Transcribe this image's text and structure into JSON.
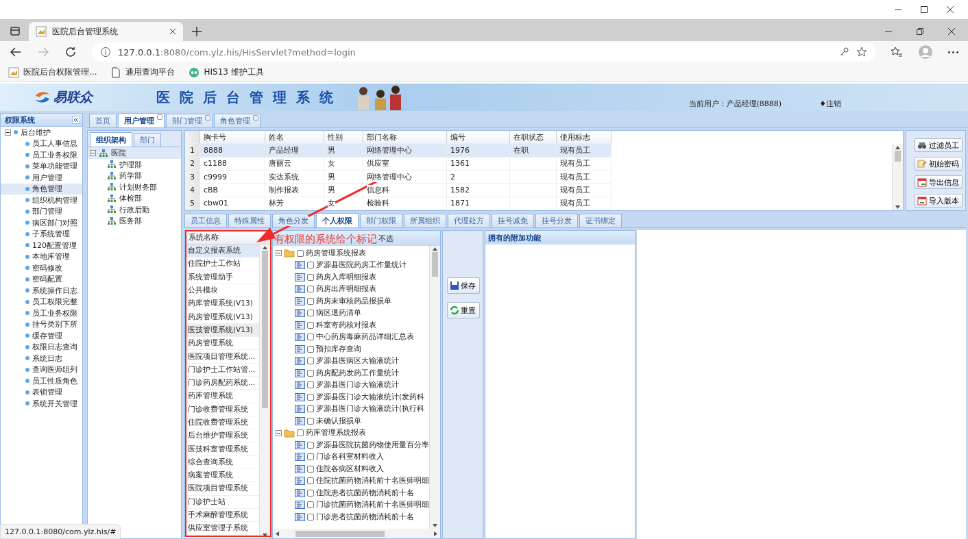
{
  "browser": {
    "tab_title": "医院后台管理系统",
    "url_host": "127.0.0.1",
    "url_rest": ":8080/com.ylz.his/HisServlet?method=login",
    "bookmarks": [
      {
        "label": "医院后台权限管理...",
        "kind": "app"
      },
      {
        "label": "通用查询平台",
        "kind": "page"
      },
      {
        "label": "HIS13 维护工具",
        "kind": "tool"
      }
    ]
  },
  "header": {
    "brand": "易联众",
    "title": "医院后台管理系统",
    "current_user": "当前用户：产品经理(8888)",
    "logout": "♦注销"
  },
  "sidebar": {
    "title": "权限系统",
    "root": {
      "label": "后台维护",
      "expanded": true,
      "children": [
        {
          "label": "员工人事信息",
          "selected": false
        },
        {
          "label": "员工业务权限",
          "selected": false
        },
        {
          "label": "菜单功能管理",
          "selected": false
        },
        {
          "label": "用户管理",
          "selected": false
        },
        {
          "label": "角色管理",
          "selected": true
        },
        {
          "label": "组织机构管理",
          "selected": false
        },
        {
          "label": "部门管理",
          "selected": false
        },
        {
          "label": "病区部门对照",
          "selected": false
        },
        {
          "label": "子系统管理",
          "selected": false
        },
        {
          "label": "120配置管理",
          "selected": false
        },
        {
          "label": "本地库管理",
          "selected": false
        },
        {
          "label": "密码修改",
          "selected": false
        },
        {
          "label": "密码配置",
          "selected": false
        },
        {
          "label": "系统操作日志",
          "selected": false
        },
        {
          "label": "员工权限完整",
          "selected": false
        },
        {
          "label": "员工业务权限",
          "selected": false
        },
        {
          "label": "挂号类别下所",
          "selected": false
        },
        {
          "label": "缓存管理",
          "selected": false
        },
        {
          "label": "权限日志查询",
          "selected": false
        },
        {
          "label": "系统日志",
          "selected": false
        },
        {
          "label": "查询医师组列",
          "selected": false
        },
        {
          "label": "员工性质角色",
          "selected": false
        },
        {
          "label": "表锁管理",
          "selected": false
        },
        {
          "label": "系统开关管理",
          "selected": false
        }
      ]
    }
  },
  "main_tabs": [
    {
      "label": "首页",
      "selected": false,
      "closable": false
    },
    {
      "label": "用户管理",
      "selected": true,
      "closable": true
    },
    {
      "label": "部门管理",
      "selected": false,
      "closable": true
    },
    {
      "label": "角色管理",
      "selected": false,
      "closable": true
    }
  ],
  "org_tabs": [
    {
      "label": "组织架构",
      "selected": true
    },
    {
      "label": "部门",
      "selected": false
    }
  ],
  "org_tree": {
    "label": "医院",
    "expanded": true,
    "selected": true,
    "children": [
      {
        "label": "护理部"
      },
      {
        "label": "药学部"
      },
      {
        "label": "计划财务部"
      },
      {
        "label": "体检部"
      },
      {
        "label": "行政后勤"
      },
      {
        "label": "医务部"
      }
    ]
  },
  "table": {
    "columns": [
      "胸卡号",
      "姓名",
      "性别",
      "部门名称",
      "编号",
      "在职状态",
      "使用标志"
    ],
    "rows": [
      {
        "index": "1",
        "selected": true,
        "cells": [
          "8888",
          "产品经理",
          "男",
          "网络管理中心",
          "1976",
          "在职",
          "现有员工"
        ]
      },
      {
        "index": "2",
        "selected": false,
        "cells": [
          "c1188",
          "唐丽云",
          "女",
          "供应室",
          "1361",
          "",
          "现有员工"
        ]
      },
      {
        "index": "3",
        "selected": false,
        "cells": [
          "c9999",
          "实达系统",
          "男",
          "网络管理中心",
          "2",
          "",
          "现有员工"
        ]
      },
      {
        "index": "4",
        "selected": false,
        "cells": [
          "cBB",
          "制作报表",
          "男",
          "信息科",
          "1582",
          "",
          "现有员工"
        ]
      },
      {
        "index": "5",
        "selected": false,
        "cells": [
          "cbw01",
          "林芳",
          "女",
          "检验科",
          "1871",
          "",
          "现有员工"
        ]
      }
    ]
  },
  "actions": [
    {
      "label": "过滤员工",
      "kind": "filter"
    },
    {
      "label": "初始密码",
      "kind": "password"
    },
    {
      "label": "导出信息",
      "kind": "export"
    },
    {
      "label": "导入版本",
      "kind": "import"
    }
  ],
  "detail_tabs": [
    {
      "label": "员工信息",
      "selected": false
    },
    {
      "label": "特殊属性",
      "selected": false
    },
    {
      "label": "角色分发",
      "selected": false
    },
    {
      "label": "个人权限",
      "selected": true
    },
    {
      "label": "部门权限",
      "selected": false
    },
    {
      "label": "所属组织",
      "selected": false
    },
    {
      "label": "代理处方",
      "selected": false
    },
    {
      "label": "挂号减免",
      "selected": false
    },
    {
      "label": "挂号分发",
      "selected": false
    },
    {
      "label": "证书绑定",
      "selected": false
    }
  ],
  "systems": {
    "header": "系统名称",
    "items": [
      {
        "label": "自定义报表系统",
        "selected": true,
        "hovered": false
      },
      {
        "label": "住院护士工作站",
        "selected": false,
        "hovered": false
      },
      {
        "label": "系统管理助手",
        "selected": false,
        "hovered": false
      },
      {
        "label": "公共模块",
        "selected": false,
        "hovered": false
      },
      {
        "label": "药库管理系统(V13)",
        "selected": false,
        "hovered": false
      },
      {
        "label": "药房管理系统(V13)",
        "selected": false,
        "hovered": false
      },
      {
        "label": "医技管理系统(V13)",
        "selected": false,
        "hovered": true
      },
      {
        "label": "药房管理系统",
        "selected": false,
        "hovered": false
      },
      {
        "label": "医院项目管理系统...",
        "selected": false,
        "hovered": false
      },
      {
        "label": "门诊护士工作站管...",
        "selected": false,
        "hovered": false
      },
      {
        "label": "门诊药房配药系统...",
        "selected": false,
        "hovered": false
      },
      {
        "label": "药库管理系统",
        "selected": false,
        "hovered": false
      },
      {
        "label": "门诊收费管理系统",
        "selected": false,
        "hovered": false
      },
      {
        "label": "住院收费管理系统",
        "selected": false,
        "hovered": false
      },
      {
        "label": "后台维护管理系统",
        "selected": false,
        "hovered": false
      },
      {
        "label": "医技科室管理系统",
        "selected": false,
        "hovered": false
      },
      {
        "label": "综合查询系统",
        "selected": false,
        "hovered": false
      },
      {
        "label": "病案管理系统",
        "selected": false,
        "hovered": false
      },
      {
        "label": "医院项目管理系统",
        "selected": false,
        "hovered": false
      },
      {
        "label": "门诊护士站",
        "selected": false,
        "hovered": false
      },
      {
        "label": "手术麻醉管理系统",
        "selected": false,
        "hovered": false
      },
      {
        "label": "供应室管理子系统",
        "selected": false,
        "hovered": false
      }
    ]
  },
  "report_tree": {
    "toolbar_label": "不选",
    "groups": [
      {
        "label": "药房管理系统报表",
        "expanded": true,
        "checked": false,
        "children": [
          {
            "label": "罗源县医院药房工作量统计",
            "checked": false
          },
          {
            "label": "药房入库明细报表",
            "checked": false
          },
          {
            "label": "药房出库明细报表",
            "checked": false
          },
          {
            "label": "药房未审核药品报损单",
            "checked": false
          },
          {
            "label": "病区退药清单",
            "checked": false
          },
          {
            "label": "科室寄药核对报表",
            "checked": false
          },
          {
            "label": "中心药房毒麻药品详细汇总表",
            "checked": false
          },
          {
            "label": "预扣库存查询",
            "checked": false
          },
          {
            "label": "罗源县医病区大输液统计",
            "checked": false
          },
          {
            "label": "药房配药发药工作量统计",
            "checked": false
          },
          {
            "label": "罗源县医门诊大输液统计",
            "checked": false
          },
          {
            "label": "罗源县医门诊大输液统计(发药科",
            "checked": false
          },
          {
            "label": "罗源县医门诊大输液统计(执行科",
            "checked": false
          },
          {
            "label": "未确认报损单",
            "checked": false
          }
        ]
      },
      {
        "label": "药库管理系统报表",
        "expanded": true,
        "checked": false,
        "children": [
          {
            "label": "罗源县医院抗菌药物使用量百分率",
            "checked": false
          },
          {
            "label": "门诊各科室材料收入",
            "checked": false
          },
          {
            "label": "住院各病区材料收入",
            "checked": false
          },
          {
            "label": "住院抗菌药物消耗前十名医师明细",
            "checked": false
          },
          {
            "label": "住院患者抗菌药物消耗前十名",
            "checked": false
          },
          {
            "label": "门诊抗菌药物消耗前十名医师明细",
            "checked": false
          },
          {
            "label": "门诊患者抗菌药物消耗前十名",
            "checked": false
          }
        ]
      }
    ]
  },
  "buttons": [
    {
      "label": "保存",
      "kind": "save"
    },
    {
      "label": "重置",
      "kind": "reset"
    }
  ],
  "extra": {
    "title": "拥有的附加功能"
  },
  "annotation": {
    "text": "有权限的系统给个标记"
  },
  "status_url": "127.0.0.1:8080/com.ylz.his/#"
}
